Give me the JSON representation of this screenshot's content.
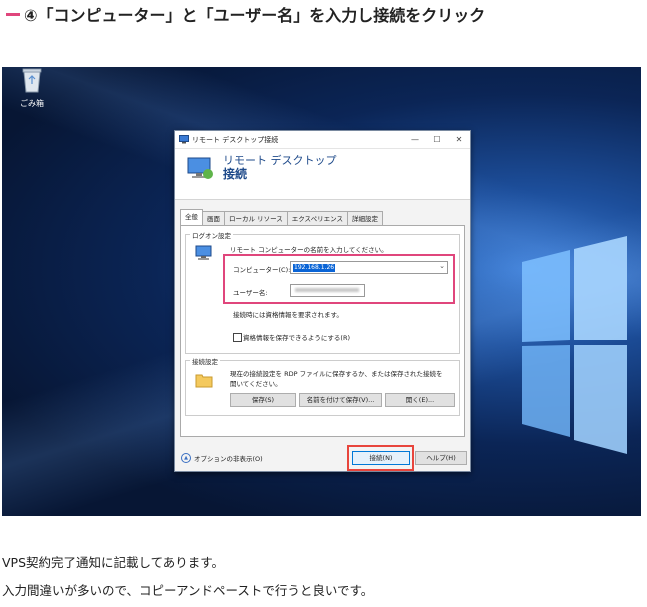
{
  "heading": {
    "text": "④「コンピューター」と「ユーザー名」を入力し接続をクリック"
  },
  "desktop": {
    "recycle_bin_label": "ごみ箱",
    "dialog": {
      "title": "リモート デスクトップ接続",
      "banner_line1": "リモート デスクトップ",
      "banner_line2": "接続",
      "tabs": [
        "全般",
        "画面",
        "ローカル リソース",
        "エクスペリエンス",
        "詳細設定"
      ],
      "logon_group_label": "ログオン設定",
      "logon_instruction": "リモート コンピューターの名前を入力してください。",
      "computer_label": "コンピューター(C):",
      "computer_value": "192.168.1.26",
      "username_label": "ユーザー名:",
      "credentials_note": "接続時には資格情報を要求されます。",
      "save_credentials_label": "資格情報を保存できるようにする(R)",
      "connection_group_label": "接続設定",
      "connection_desc_line1": "現在の接続設定を RDP ファイルに保存するか、または保存された接続を",
      "connection_desc_line2": "開いてください。",
      "save_button": "保存(S)",
      "save_as_button": "名前を付けて保存(V)...",
      "open_button": "開く(E)...",
      "options_toggle": "オプションの非表示(O)",
      "connect_button": "接続(N)",
      "help_button": "ヘルプ(H)"
    }
  },
  "captions": [
    "VPS契約完了通知に記載してあります。",
    "入力間違いが多いので、コピーアンドペーストで行うと良いです。"
  ],
  "colors": {
    "accent_pink": "#e0467c",
    "accent_red": "#e8453c",
    "desktop_blue": "#0b2556"
  }
}
